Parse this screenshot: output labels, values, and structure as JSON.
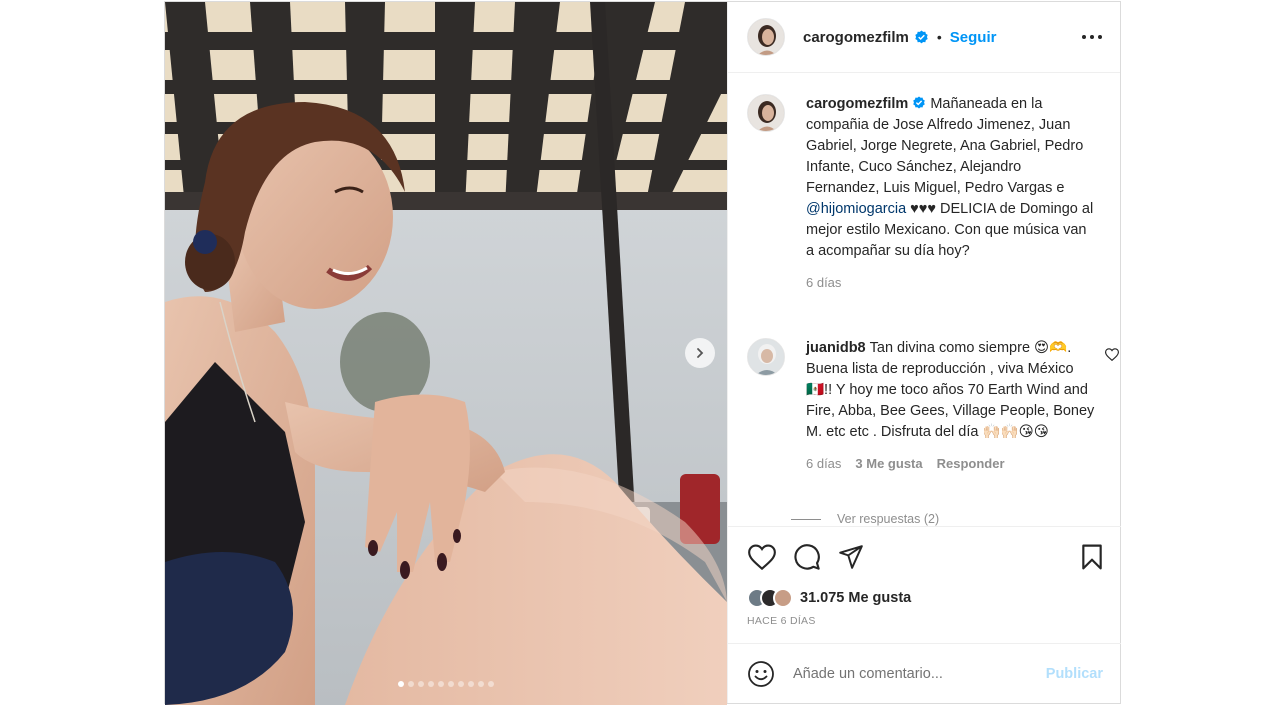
{
  "post": {
    "author": {
      "username": "carogomezfilm",
      "verified": true
    },
    "header": {
      "separator": "•",
      "follow_label": "Seguir"
    },
    "carousel": {
      "slide_count": 10,
      "active_slide": 1
    },
    "caption": {
      "username": "carogomezfilm",
      "text_before_mention": "Mañaneada en la compañia de Jose Alfredo Jimenez, Juan Gabriel, Jorge Negrete, Ana Gabriel, Pedro Infante, Cuco Sánchez, Alejandro Fernandez, Luis Miguel, Pedro Vargas e ",
      "mention": "@hijomiogarcia",
      "text_after_mention": " ♥♥♥ DELICIA de Domingo al mejor estilo Mexicano. Con que música van a acompañar su día hoy?",
      "time": "6 días"
    },
    "comments": [
      {
        "username": "juanidb8",
        "text": "Tan divina como siempre 😍🫶. Buena lista de reproducción , viva México 🇲🇽!! Y hoy me toco años 70 Earth Wind and Fire, Abba, Bee Gees, Village People, Boney M. etc etc . Disfruta del día 🙌🏻🙌🏻😘😘",
        "time": "6 días",
        "likes": "3 Me gusta",
        "reply_label": "Responder",
        "view_replies": "Ver respuestas (2)"
      }
    ],
    "likes_count": "31.075 Me gusta",
    "posted_ago": "HACE 6 DÍAS",
    "add_comment": {
      "placeholder": "Añade un comentario...",
      "publish_label": "Publicar"
    }
  },
  "colors": {
    "accent": "#0095f6",
    "text": "#262626",
    "muted": "#8e8e8e",
    "publish_disabled": "#b2dffc"
  },
  "icons": [
    "verified-badge-icon",
    "more-options-icon",
    "chevron-right-icon",
    "heart-icon",
    "comment-icon",
    "share-icon",
    "bookmark-icon",
    "emoji-icon"
  ]
}
